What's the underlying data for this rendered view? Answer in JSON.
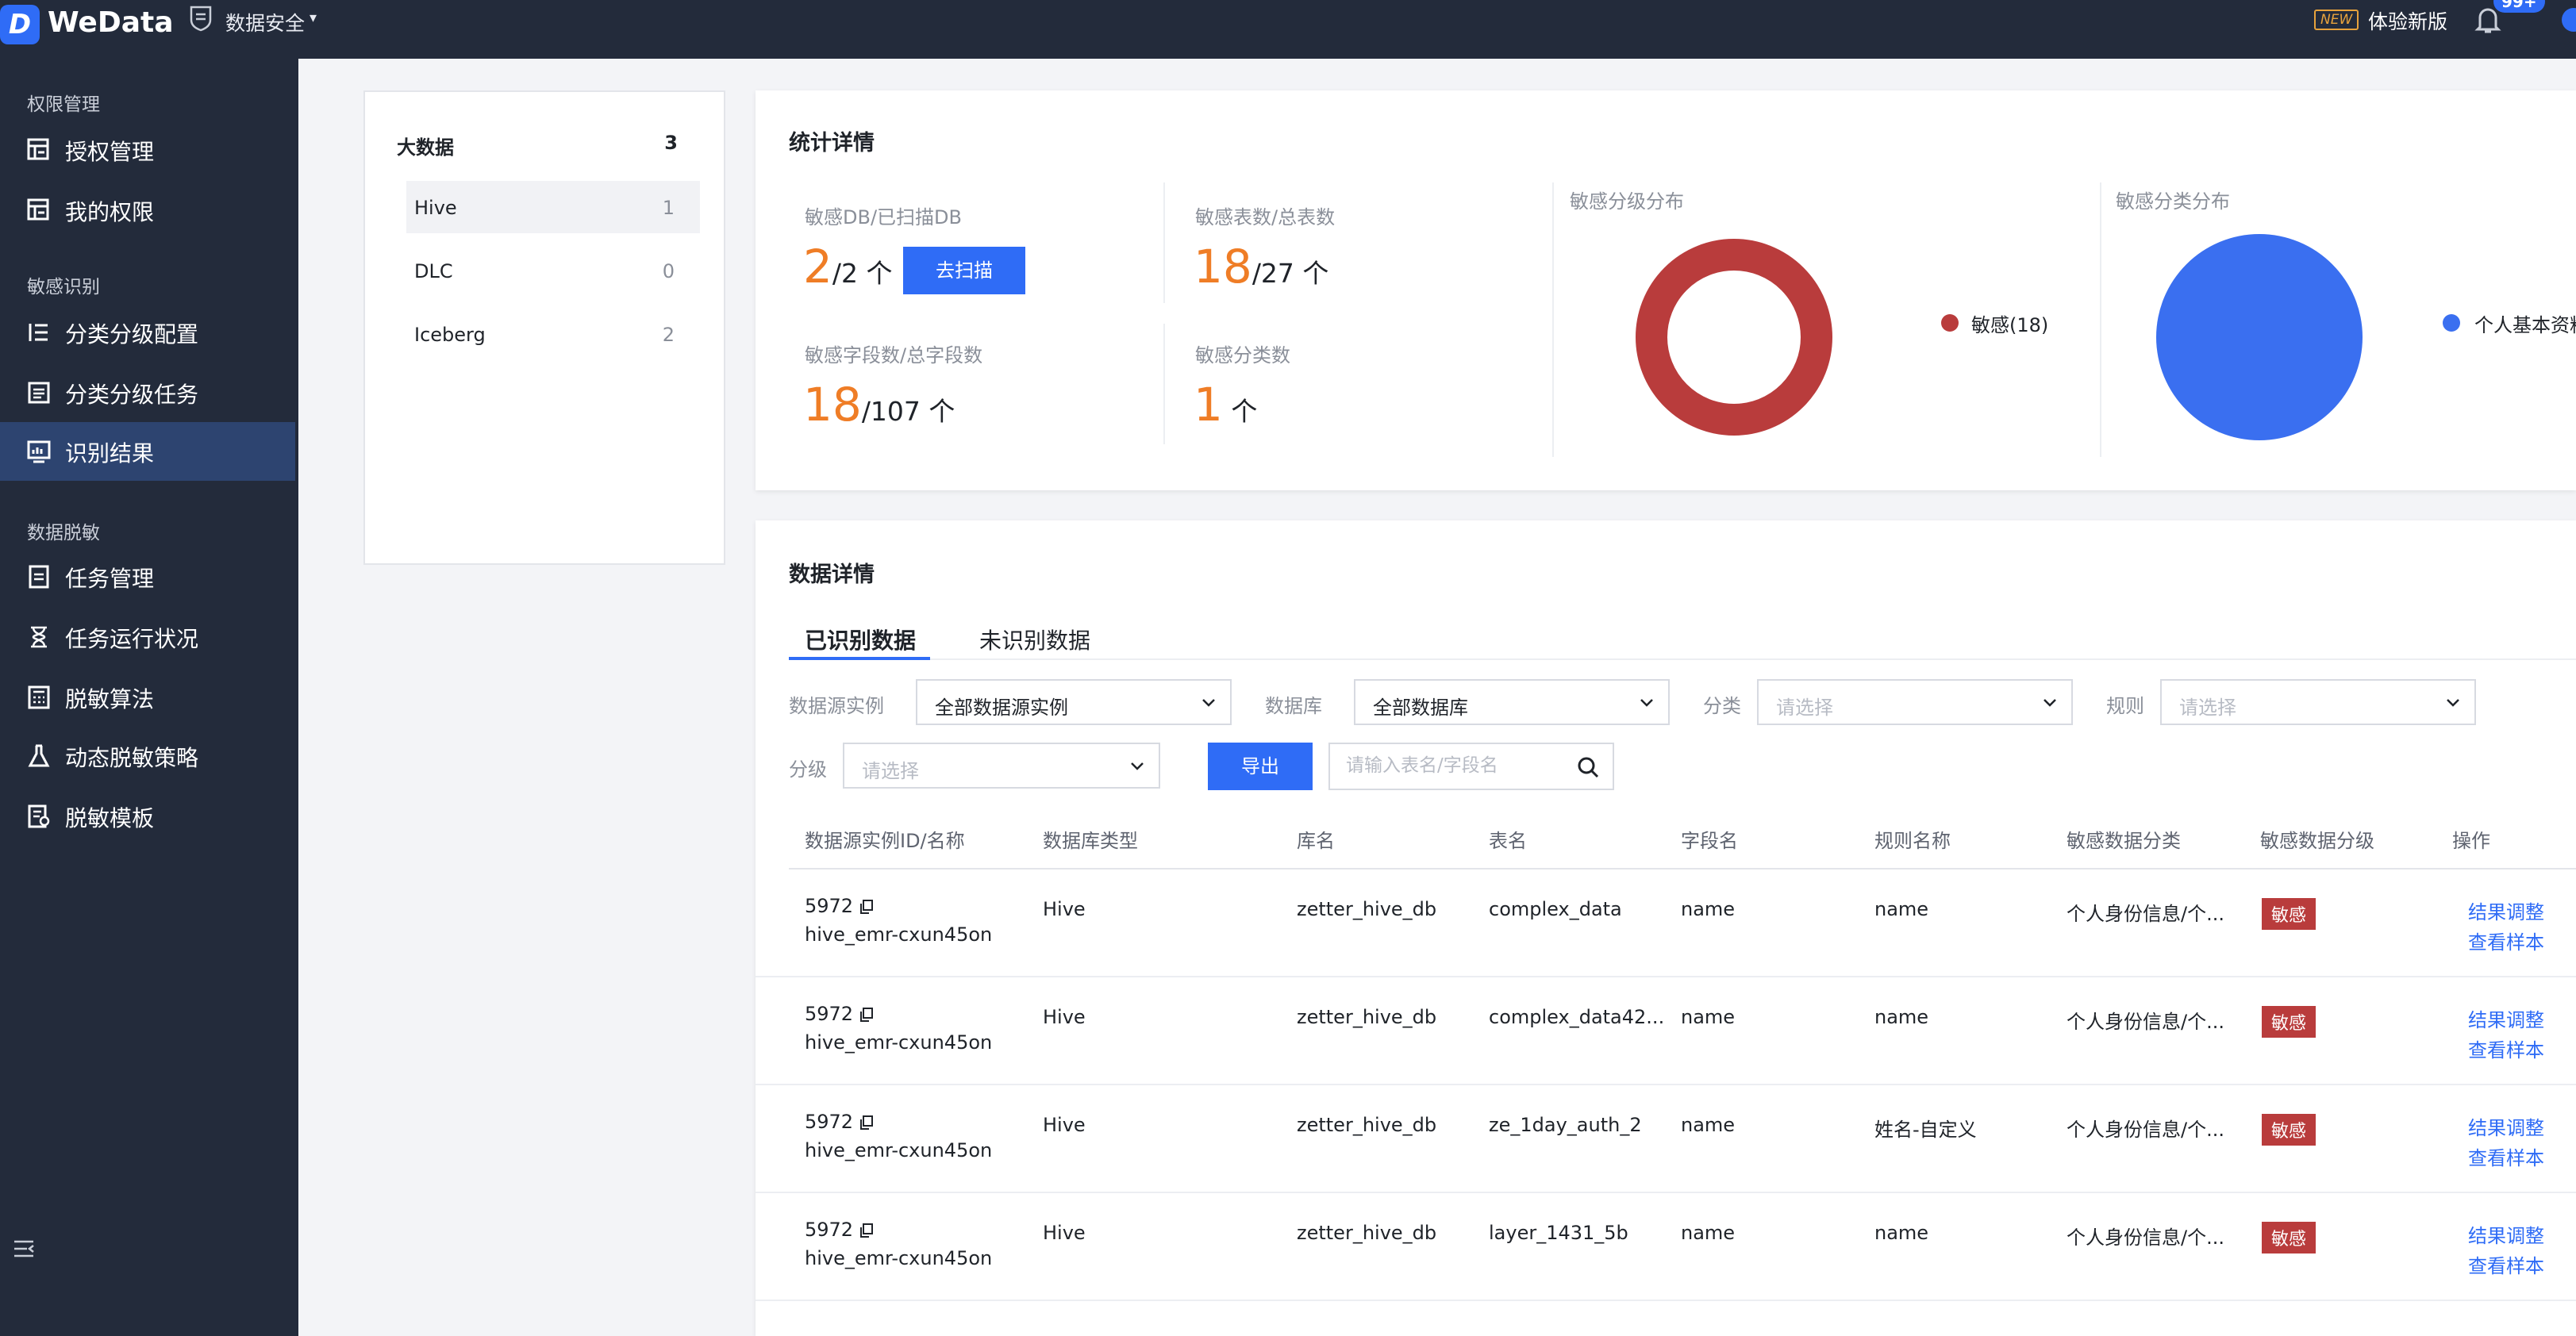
{
  "topbar": {
    "logo_letter": "D",
    "app_name": "WeData",
    "module": "数据安全",
    "new_badge": "NEW",
    "new_version": "体验新版",
    "notify_count": "99+"
  },
  "sidebar": {
    "groups": [
      {
        "label": "权限管理"
      },
      {
        "label": "敏感识别"
      },
      {
        "label": "数据脱敏"
      }
    ],
    "items": [
      {
        "label": "授权管理",
        "icon": "grid-key-icon"
      },
      {
        "label": "我的权限",
        "icon": "grid-key-icon"
      },
      {
        "label": "分类分级配置",
        "icon": "list-config-icon"
      },
      {
        "label": "分类分级任务",
        "icon": "task-list-icon"
      },
      {
        "label": "识别结果",
        "icon": "monitor-chart-icon",
        "active": true
      },
      {
        "label": "任务管理",
        "icon": "document-icon"
      },
      {
        "label": "任务运行状况",
        "icon": "hourglass-icon"
      },
      {
        "label": "脱敏算法",
        "icon": "calculator-icon"
      },
      {
        "label": "动态脱敏策略",
        "icon": "flask-icon"
      },
      {
        "label": "脱敏模板",
        "icon": "template-icon"
      }
    ]
  },
  "left_panel": {
    "title": "大数据",
    "count": "3",
    "items": [
      {
        "name": "Hive",
        "count": "1"
      },
      {
        "name": "DLC",
        "count": "0"
      },
      {
        "name": "Iceberg",
        "count": "2"
      }
    ]
  },
  "stats": {
    "title": "统计详情",
    "db": {
      "label": "敏感DB/已扫描DB",
      "value": "2",
      "total": "/2",
      "unit": "个"
    },
    "scan_button": "去扫描",
    "tables": {
      "label": "敏感表数/总表数",
      "value": "18",
      "total": "/27",
      "unit": "个"
    },
    "fields": {
      "label": "敏感字段数/总字段数",
      "value": "18",
      "total": "/107",
      "unit": "个"
    },
    "categories": {
      "label": "敏感分类数",
      "value": "1",
      "unit": "个"
    },
    "level_chart": {
      "title": "敏感分级分布",
      "legend": "敏感(18)",
      "color": "#b93c3c"
    },
    "category_chart": {
      "title": "敏感分类分布",
      "legend": "个人基本资料",
      "color": "#3a6ff0"
    }
  },
  "chart_data": [
    {
      "type": "pie",
      "title": "敏感分级分布",
      "donut": true,
      "categories": [
        "敏感"
      ],
      "values": [
        18
      ],
      "colors": [
        "#b93c3c"
      ]
    },
    {
      "type": "pie",
      "title": "敏感分类分布",
      "donut": false,
      "categories": [
        "个人基本资料"
      ],
      "values": [
        18
      ],
      "colors": [
        "#3a6ff0"
      ]
    }
  ],
  "details": {
    "title": "数据详情",
    "tabs": [
      "已识别数据",
      "未识别数据"
    ],
    "filters": {
      "instance": {
        "label": "数据源实例",
        "value": "全部数据源实例"
      },
      "database": {
        "label": "数据库",
        "value": "全部数据库"
      },
      "category": {
        "label": "分类",
        "placeholder": "请选择"
      },
      "rule": {
        "label": "规则",
        "placeholder": "请选择"
      },
      "level": {
        "label": "分级",
        "placeholder": "请选择"
      }
    },
    "export_button": "导出",
    "search_placeholder": "请输入表名/字段名",
    "columns": [
      "数据源实例ID/名称",
      "数据库类型",
      "库名",
      "表名",
      "字段名",
      "规则名称",
      "敏感数据分类",
      "敏感数据分级",
      "操作"
    ],
    "rows": [
      {
        "instance_id": "5972",
        "instance_name": "hive_emr-cxun45on",
        "db_type": "Hive",
        "db_name": "zetter_hive_db",
        "table": "complex_data",
        "field": "name",
        "rule": "name",
        "category": "个人身份信息/个...",
        "level": "敏感",
        "op1": "结果调整",
        "op2": "查看样本"
      },
      {
        "instance_id": "5972",
        "instance_name": "hive_emr-cxun45on",
        "db_type": "Hive",
        "db_name": "zetter_hive_db",
        "table": "complex_data42...",
        "field": "name",
        "rule": "name",
        "category": "个人身份信息/个...",
        "level": "敏感",
        "op1": "结果调整",
        "op2": "查看样本"
      },
      {
        "instance_id": "5972",
        "instance_name": "hive_emr-cxun45on",
        "db_type": "Hive",
        "db_name": "zetter_hive_db",
        "table": "ze_1day_auth_2",
        "field": "name",
        "rule": "姓名-自定义",
        "category": "个人身份信息/个...",
        "level": "敏感",
        "op1": "结果调整",
        "op2": "查看样本"
      },
      {
        "instance_id": "5972",
        "instance_name": "hive_emr-cxun45on",
        "db_type": "Hive",
        "db_name": "zetter_hive_db",
        "table": "layer_1431_5b",
        "field": "name",
        "rule": "name",
        "category": "个人身份信息/个...",
        "level": "敏感",
        "op1": "结果调整",
        "op2": "查看样本"
      }
    ]
  }
}
